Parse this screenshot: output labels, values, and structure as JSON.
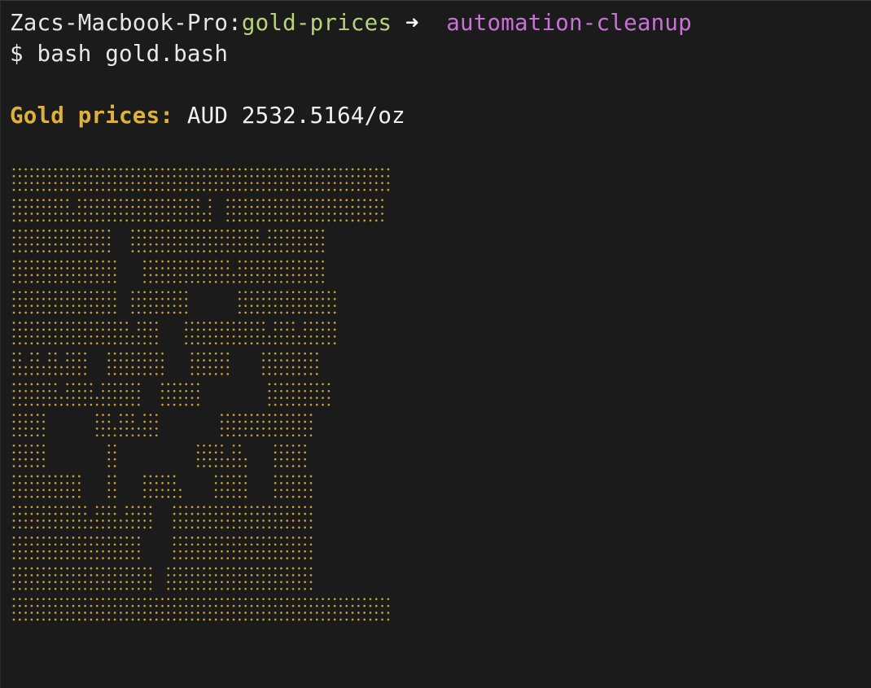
{
  "terminal": {
    "prompt": {
      "host": "Zacs-Macbook-Pro",
      "separator": ":",
      "directory": "gold-prices",
      "arrow": " ➜  ",
      "branch": "automation-cleanup"
    },
    "command": {
      "symbol": "$",
      "text": " bash gold.bash"
    },
    "output": {
      "label": "Gold prices:",
      "value": " AUD 2532.5164/oz"
    }
  },
  "art": {
    "type": "braille-dot-matrix",
    "color": "#c9a12a",
    "description_icon": "gold-bars-icon",
    "rows": [
      "################################################################",
      "##########-#####################-#  ###########################",
      "#################   ######################-##########",
      "##################    ###############-###############",
      "##################  ##########        #################",
      "####################-####    ##############-####-######",
      "##-##-##-####   ##########    #######     ##########",
      "########-#####-#######   #######           ###########",
      "######        ###-###-###          ################",
      "######          ##             #####-##-    ######",
      "############    ##    ######-     ######    #######",
      "#############-####-#####   ########################",
      "######################     ########################",
      "########################  #########################",
      "################################################################"
    ]
  }
}
